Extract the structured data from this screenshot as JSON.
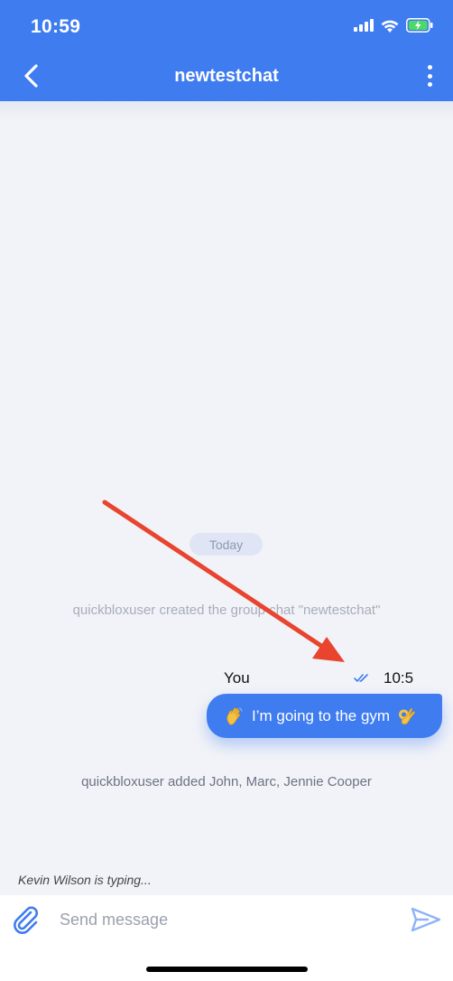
{
  "status_bar": {
    "time": "10:59",
    "icons": [
      "signal-icon",
      "wifi-icon",
      "battery-charging-icon"
    ]
  },
  "header": {
    "title": "newtestchat",
    "back_icon": "chevron-left-icon",
    "menu_icon": "more-vertical-icon"
  },
  "chat": {
    "date_separator": "Today",
    "system_messages": [
      "quickbloxuser created the group chat \"newtestchat\"",
      "quickbloxuser added John, Marc, Jennie Cooper"
    ],
    "outgoing_message": {
      "sender": "You",
      "time": "10:5",
      "status_icon": "double-check-icon",
      "text": "I’m going to the gym",
      "emoji_leading": "waving-hand-emoji",
      "emoji_trailing": "ok-hand-emoji"
    }
  },
  "typing_indicator": "Kevin Wilson is typing...",
  "composer": {
    "placeholder": "Send message",
    "attach_icon": "paperclip-icon",
    "send_icon": "send-icon"
  },
  "colors": {
    "primary": "#3e7cf0",
    "background": "#f2f3f8",
    "annotation_arrow": "#e8442e"
  }
}
